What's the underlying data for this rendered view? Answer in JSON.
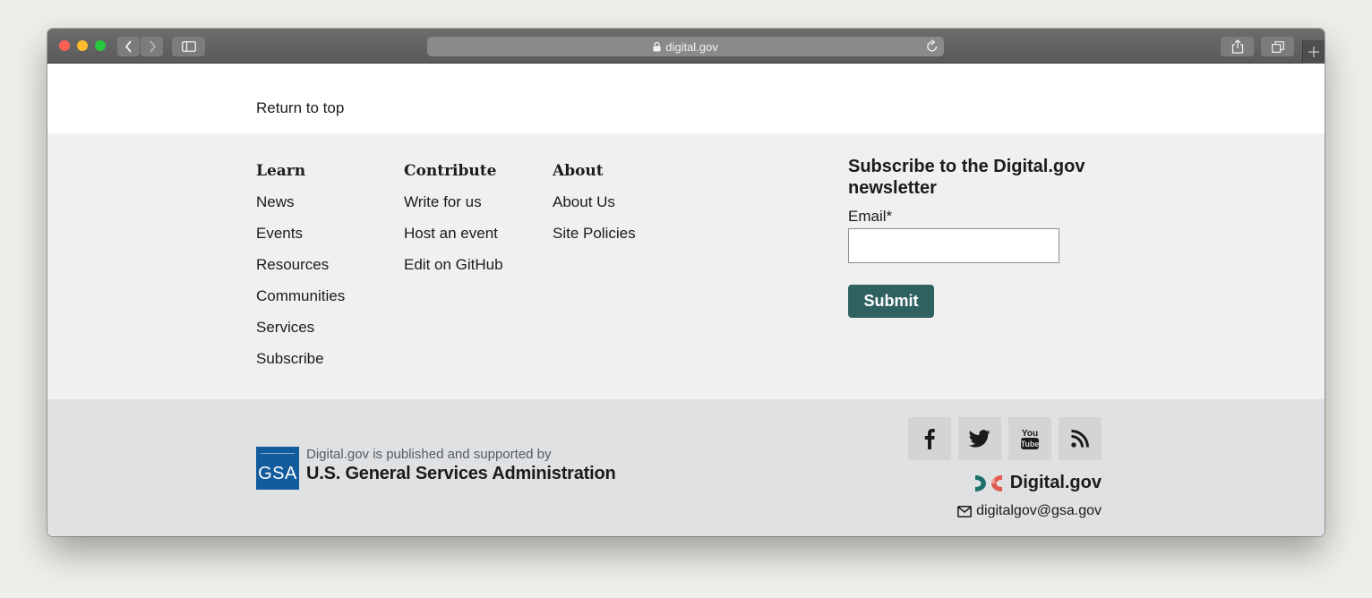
{
  "browser": {
    "url": "digital.gov"
  },
  "page": {
    "return_to_top": "Return to top",
    "columns": [
      {
        "heading": "Learn",
        "links": [
          "News",
          "Events",
          "Resources",
          "Communities",
          "Services",
          "Subscribe"
        ]
      },
      {
        "heading": "Contribute",
        "links": [
          "Write for us",
          "Host an event",
          "Edit on GitHub"
        ]
      },
      {
        "heading": "About",
        "links": [
          "About Us",
          "Site Policies"
        ]
      }
    ],
    "newsletter": {
      "title": "Subscribe to the Digital.gov newsletter",
      "email_label": "Email*",
      "email_value": "",
      "submit_label": "Submit"
    },
    "publisher": {
      "logo_text": "GSA",
      "line": "Digital.gov is published and supported by",
      "org": "U.S. General Services Administration"
    },
    "social": [
      {
        "name": "facebook-icon",
        "glyph": "f"
      },
      {
        "name": "twitter-icon",
        "glyph": ""
      },
      {
        "name": "youtube-icon",
        "glyph": "You Tube"
      },
      {
        "name": "rss-icon",
        "glyph": ""
      }
    ],
    "brand": "Digital.gov",
    "contact_email": "digitalgov@gsa.gov",
    "colors": {
      "submit_bg": "#2e6160",
      "gsa_blue": "#125b9d",
      "footer_main_bg": "#f0f0f0",
      "footer_bottom_bg": "#dfe1e2",
      "brand_teal": "#1a6f6a",
      "brand_red": "#e05a4f"
    }
  }
}
